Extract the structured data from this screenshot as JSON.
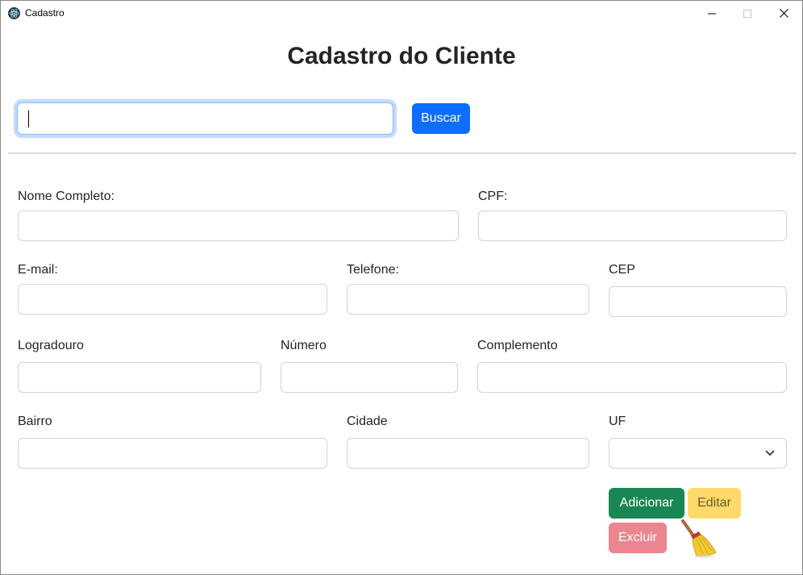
{
  "window": {
    "title": "Cadastro",
    "app_icon": "electron-atom-icon",
    "controls": [
      "minimize-icon",
      "maximize-icon",
      "close-icon"
    ]
  },
  "page": {
    "title": "Cadastro do Cliente"
  },
  "search": {
    "value": "",
    "placeholder": "",
    "button_label": "Buscar"
  },
  "form": {
    "nome": {
      "label": "Nome Completo:",
      "value": ""
    },
    "cpf": {
      "label": "CPF:",
      "value": ""
    },
    "email": {
      "label": "E-mail:",
      "value": ""
    },
    "telefone": {
      "label": "Telefone:",
      "value": ""
    },
    "cep": {
      "label": "CEP",
      "value": ""
    },
    "logradouro": {
      "label": "Logradouro",
      "value": ""
    },
    "numero": {
      "label": "Número",
      "value": ""
    },
    "complemento": {
      "label": "Complemento",
      "value": ""
    },
    "bairro": {
      "label": "Bairro",
      "value": ""
    },
    "cidade": {
      "label": "Cidade",
      "value": ""
    },
    "uf": {
      "label": "UF",
      "selected": ""
    }
  },
  "actions": {
    "add_label": "Adicionar",
    "edit_label": "Editar",
    "delete_label": "Excluir",
    "clear_icon": "broom-icon"
  },
  "colors": {
    "primary": "#0d6efd",
    "success": "#198754",
    "warning": "#ffda6a",
    "danger": "#ea868f"
  }
}
